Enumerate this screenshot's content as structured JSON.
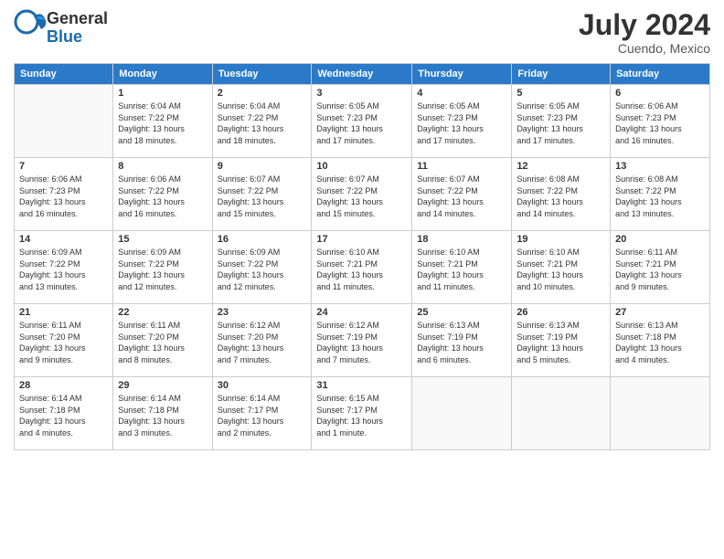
{
  "header": {
    "logo_general": "General",
    "logo_blue": "Blue",
    "month": "July 2024",
    "location": "Cuendo, Mexico"
  },
  "weekdays": [
    "Sunday",
    "Monday",
    "Tuesday",
    "Wednesday",
    "Thursday",
    "Friday",
    "Saturday"
  ],
  "weeks": [
    [
      {
        "day": "",
        "sunrise": "",
        "sunset": "",
        "daylight": ""
      },
      {
        "day": "1",
        "sunrise": "Sunrise: 6:04 AM",
        "sunset": "Sunset: 7:22 PM",
        "daylight": "Daylight: 13 hours and 18 minutes."
      },
      {
        "day": "2",
        "sunrise": "Sunrise: 6:04 AM",
        "sunset": "Sunset: 7:22 PM",
        "daylight": "Daylight: 13 hours and 18 minutes."
      },
      {
        "day": "3",
        "sunrise": "Sunrise: 6:05 AM",
        "sunset": "Sunset: 7:23 PM",
        "daylight": "Daylight: 13 hours and 17 minutes."
      },
      {
        "day": "4",
        "sunrise": "Sunrise: 6:05 AM",
        "sunset": "Sunset: 7:23 PM",
        "daylight": "Daylight: 13 hours and 17 minutes."
      },
      {
        "day": "5",
        "sunrise": "Sunrise: 6:05 AM",
        "sunset": "Sunset: 7:23 PM",
        "daylight": "Daylight: 13 hours and 17 minutes."
      },
      {
        "day": "6",
        "sunrise": "Sunrise: 6:06 AM",
        "sunset": "Sunset: 7:23 PM",
        "daylight": "Daylight: 13 hours and 16 minutes."
      }
    ],
    [
      {
        "day": "7",
        "sunrise": "Sunrise: 6:06 AM",
        "sunset": "Sunset: 7:23 PM",
        "daylight": "Daylight: 13 hours and 16 minutes."
      },
      {
        "day": "8",
        "sunrise": "Sunrise: 6:06 AM",
        "sunset": "Sunset: 7:22 PM",
        "daylight": "Daylight: 13 hours and 16 minutes."
      },
      {
        "day": "9",
        "sunrise": "Sunrise: 6:07 AM",
        "sunset": "Sunset: 7:22 PM",
        "daylight": "Daylight: 13 hours and 15 minutes."
      },
      {
        "day": "10",
        "sunrise": "Sunrise: 6:07 AM",
        "sunset": "Sunset: 7:22 PM",
        "daylight": "Daylight: 13 hours and 15 minutes."
      },
      {
        "day": "11",
        "sunrise": "Sunrise: 6:07 AM",
        "sunset": "Sunset: 7:22 PM",
        "daylight": "Daylight: 13 hours and 14 minutes."
      },
      {
        "day": "12",
        "sunrise": "Sunrise: 6:08 AM",
        "sunset": "Sunset: 7:22 PM",
        "daylight": "Daylight: 13 hours and 14 minutes."
      },
      {
        "day": "13",
        "sunrise": "Sunrise: 6:08 AM",
        "sunset": "Sunset: 7:22 PM",
        "daylight": "Daylight: 13 hours and 13 minutes."
      }
    ],
    [
      {
        "day": "14",
        "sunrise": "Sunrise: 6:09 AM",
        "sunset": "Sunset: 7:22 PM",
        "daylight": "Daylight: 13 hours and 13 minutes."
      },
      {
        "day": "15",
        "sunrise": "Sunrise: 6:09 AM",
        "sunset": "Sunset: 7:22 PM",
        "daylight": "Daylight: 13 hours and 12 minutes."
      },
      {
        "day": "16",
        "sunrise": "Sunrise: 6:09 AM",
        "sunset": "Sunset: 7:22 PM",
        "daylight": "Daylight: 13 hours and 12 minutes."
      },
      {
        "day": "17",
        "sunrise": "Sunrise: 6:10 AM",
        "sunset": "Sunset: 7:21 PM",
        "daylight": "Daylight: 13 hours and 11 minutes."
      },
      {
        "day": "18",
        "sunrise": "Sunrise: 6:10 AM",
        "sunset": "Sunset: 7:21 PM",
        "daylight": "Daylight: 13 hours and 11 minutes."
      },
      {
        "day": "19",
        "sunrise": "Sunrise: 6:10 AM",
        "sunset": "Sunset: 7:21 PM",
        "daylight": "Daylight: 13 hours and 10 minutes."
      },
      {
        "day": "20",
        "sunrise": "Sunrise: 6:11 AM",
        "sunset": "Sunset: 7:21 PM",
        "daylight": "Daylight: 13 hours and 9 minutes."
      }
    ],
    [
      {
        "day": "21",
        "sunrise": "Sunrise: 6:11 AM",
        "sunset": "Sunset: 7:20 PM",
        "daylight": "Daylight: 13 hours and 9 minutes."
      },
      {
        "day": "22",
        "sunrise": "Sunrise: 6:11 AM",
        "sunset": "Sunset: 7:20 PM",
        "daylight": "Daylight: 13 hours and 8 minutes."
      },
      {
        "day": "23",
        "sunrise": "Sunrise: 6:12 AM",
        "sunset": "Sunset: 7:20 PM",
        "daylight": "Daylight: 13 hours and 7 minutes."
      },
      {
        "day": "24",
        "sunrise": "Sunrise: 6:12 AM",
        "sunset": "Sunset: 7:19 PM",
        "daylight": "Daylight: 13 hours and 7 minutes."
      },
      {
        "day": "25",
        "sunrise": "Sunrise: 6:13 AM",
        "sunset": "Sunset: 7:19 PM",
        "daylight": "Daylight: 13 hours and 6 minutes."
      },
      {
        "day": "26",
        "sunrise": "Sunrise: 6:13 AM",
        "sunset": "Sunset: 7:19 PM",
        "daylight": "Daylight: 13 hours and 5 minutes."
      },
      {
        "day": "27",
        "sunrise": "Sunrise: 6:13 AM",
        "sunset": "Sunset: 7:18 PM",
        "daylight": "Daylight: 13 hours and 4 minutes."
      }
    ],
    [
      {
        "day": "28",
        "sunrise": "Sunrise: 6:14 AM",
        "sunset": "Sunset: 7:18 PM",
        "daylight": "Daylight: 13 hours and 4 minutes."
      },
      {
        "day": "29",
        "sunrise": "Sunrise: 6:14 AM",
        "sunset": "Sunset: 7:18 PM",
        "daylight": "Daylight: 13 hours and 3 minutes."
      },
      {
        "day": "30",
        "sunrise": "Sunrise: 6:14 AM",
        "sunset": "Sunset: 7:17 PM",
        "daylight": "Daylight: 13 hours and 2 minutes."
      },
      {
        "day": "31",
        "sunrise": "Sunrise: 6:15 AM",
        "sunset": "Sunset: 7:17 PM",
        "daylight": "Daylight: 13 hours and 1 minute."
      },
      {
        "day": "",
        "sunrise": "",
        "sunset": "",
        "daylight": ""
      },
      {
        "day": "",
        "sunrise": "",
        "sunset": "",
        "daylight": ""
      },
      {
        "day": "",
        "sunrise": "",
        "sunset": "",
        "daylight": ""
      }
    ]
  ]
}
